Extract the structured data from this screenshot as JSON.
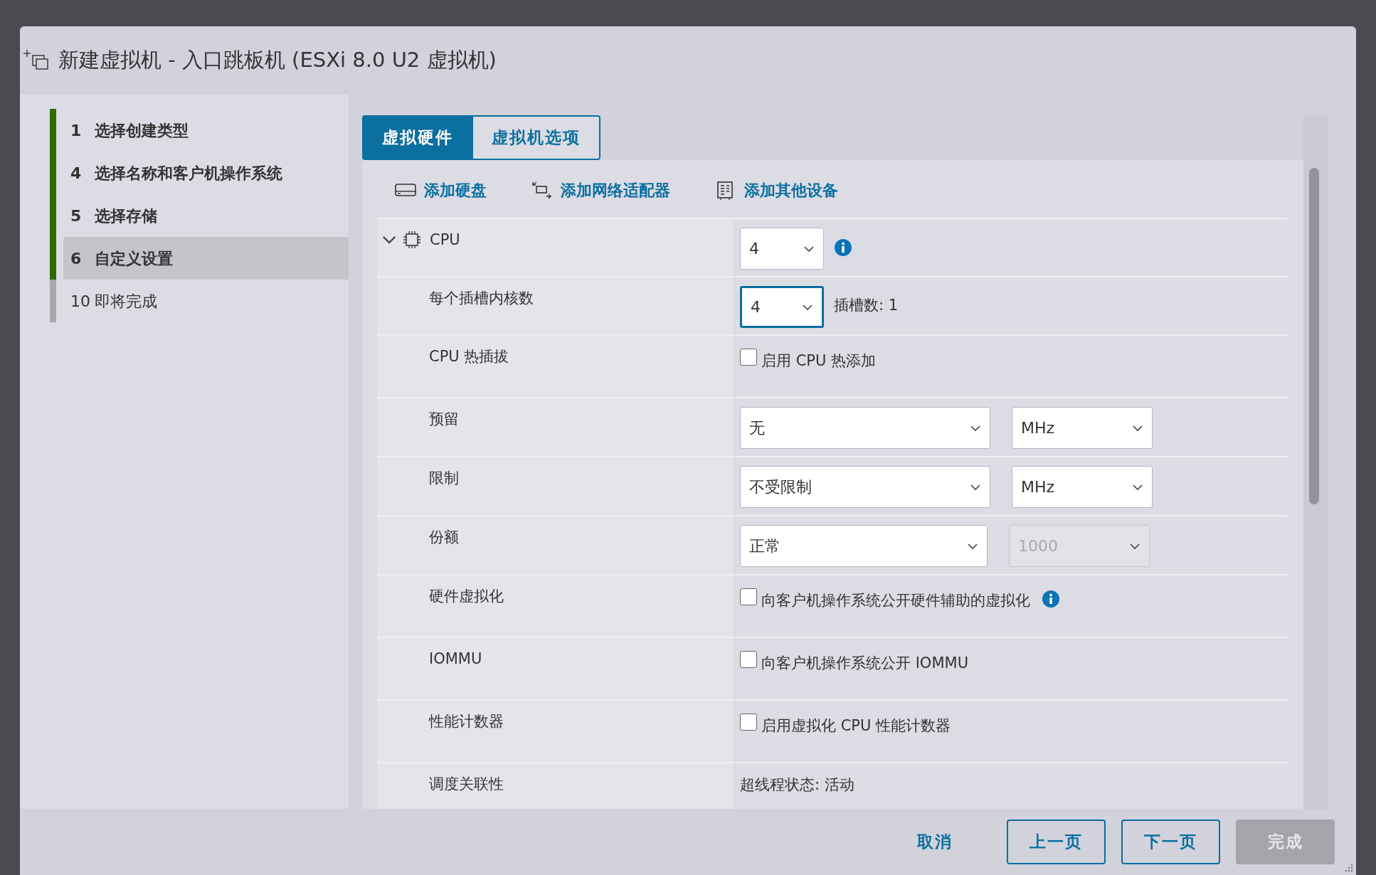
{
  "window": {
    "title": "新建虚拟机 - 入口跳板机 (ESXi 8.0 U2 虚拟机)"
  },
  "steps": [
    {
      "number": "1",
      "label": "选择创建类型",
      "done": true,
      "selected": false
    },
    {
      "number": "4",
      "label": "选择名称和客户机操作系统",
      "done": true,
      "selected": false
    },
    {
      "number": "5",
      "label": "选择存储",
      "done": true,
      "selected": false
    },
    {
      "number": "6",
      "label": "自定义设置",
      "done": true,
      "selected": true
    },
    {
      "number": "10",
      "label": "即将完成",
      "done": false,
      "selected": false
    }
  ],
  "tabs": [
    {
      "label": "虚拟硬件",
      "selected": true
    },
    {
      "label": "虚拟机选项",
      "selected": false
    }
  ],
  "toolbar": [
    {
      "kind": "disk",
      "label": "添加硬盘"
    },
    {
      "kind": "network",
      "label": "添加网络适配器"
    },
    {
      "kind": "device",
      "label": "添加其他设备"
    }
  ],
  "rows": [
    {
      "kind": "select",
      "label": "CPU",
      "expanded": true,
      "value": "4",
      "info": true
    },
    {
      "kind": "select",
      "label": "每个插槽内核数",
      "value": "4",
      "focused": true,
      "note": "插槽数: 1"
    },
    {
      "kind": "checkbox",
      "label": "CPU 热插拔",
      "text": "启用 CPU 热添加",
      "checked": false
    },
    {
      "kind": "select_pair",
      "label": "预留",
      "value": "无",
      "unit": "MHz",
      "unit_disabled": false
    },
    {
      "kind": "select_pair",
      "label": "限制",
      "value": "不受限制",
      "unit": "MHz",
      "unit_disabled": false
    },
    {
      "kind": "select_pair",
      "label": "份额",
      "value": "正常",
      "unit": "1000",
      "unit_disabled": true
    },
    {
      "kind": "checkbox",
      "label": "硬件虚拟化",
      "text": "向客户机操作系统公开硬件辅助的虚拟化",
      "checked": false,
      "info": true
    },
    {
      "kind": "checkbox",
      "label": "IOMMU",
      "text": "向客户机操作系统公开 IOMMU",
      "checked": false
    },
    {
      "kind": "checkbox",
      "label": "性能计数器",
      "text": "启用虚拟化 CPU 性能计数器",
      "checked": false
    },
    {
      "kind": "text_lines",
      "label": "调度关联性",
      "lines": [
        "超线程状态: 活动"
      ]
    }
  ],
  "buttons": [
    {
      "kind": "link",
      "label": "取消",
      "disabled": false
    },
    {
      "kind": "outline",
      "label": "上一页",
      "disabled": false
    },
    {
      "kind": "outline",
      "label": "下一页",
      "disabled": false
    },
    {
      "kind": "primary",
      "label": "完成",
      "disabled": true
    }
  ]
}
